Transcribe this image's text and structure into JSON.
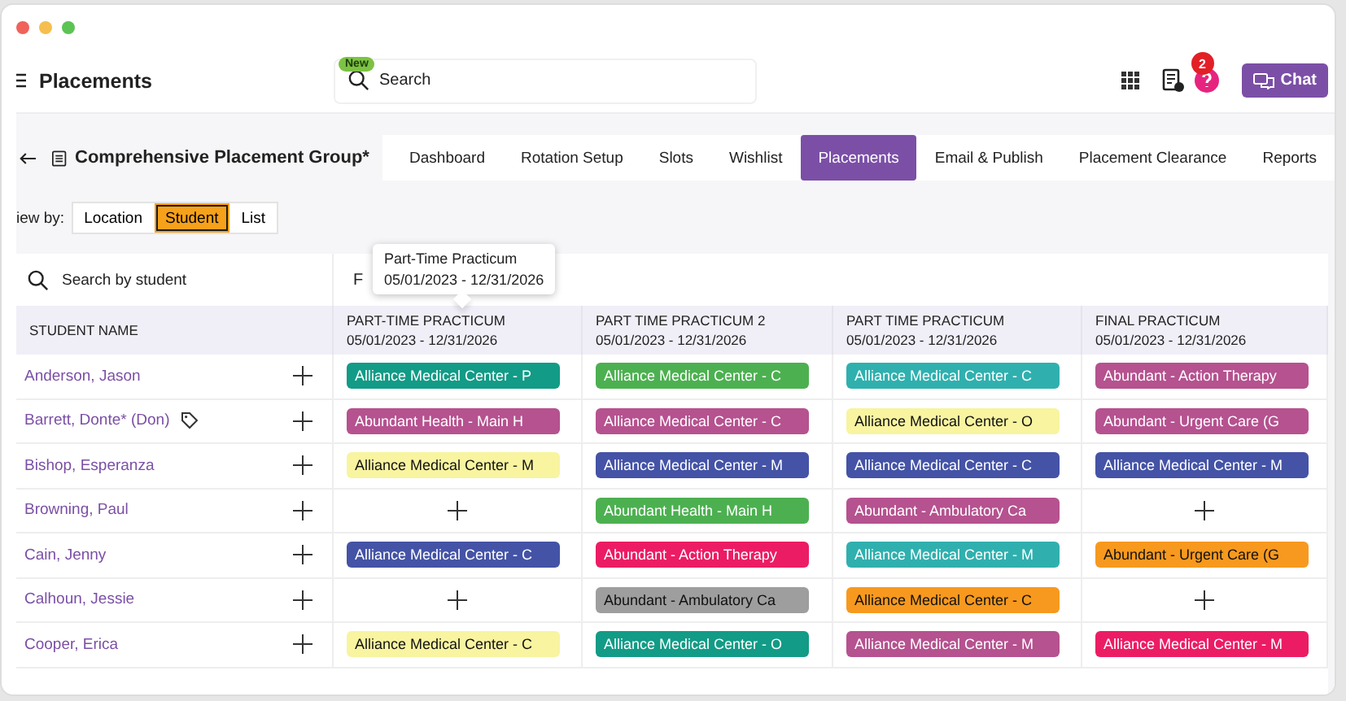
{
  "header": {
    "title": "Placements",
    "badge": "New",
    "search": {
      "placeholder": "Search"
    },
    "notification_count": "2",
    "chat_button": "Chat"
  },
  "group": {
    "title": "Comprehensive Placement Group*"
  },
  "tabs": [
    {
      "label": "Dashboard",
      "selected": false
    },
    {
      "label": "Rotation Setup",
      "selected": false
    },
    {
      "label": "Slots",
      "selected": false
    },
    {
      "label": "Wishlist",
      "selected": false
    },
    {
      "label": "Placements",
      "selected": true
    },
    {
      "label": "Email & Publish",
      "selected": false
    },
    {
      "label": "Placement Clearance",
      "selected": false
    },
    {
      "label": "Reports",
      "selected": false
    }
  ],
  "view_by": {
    "label": "iew by:",
    "options": [
      {
        "label": "Location",
        "selected": false
      },
      {
        "label": "Student",
        "selected": true
      },
      {
        "label": "List",
        "selected": false
      }
    ]
  },
  "student_search": {
    "placeholder": "Search by student"
  },
  "filter": {
    "label": "F"
  },
  "tooltip": {
    "title": "Part-Time Practicum",
    "dates": "05/01/2023 - 12/31/2026"
  },
  "table": {
    "columns": [
      {
        "title": "STUDENT NAME"
      },
      {
        "title": "PART-TIME PRACTICUM",
        "dates": "05/01/2023 - 12/31/2026"
      },
      {
        "title": "PART TIME PRACTICUM 2",
        "dates": "05/01/2023 - 12/31/2026"
      },
      {
        "title": "PART TIME PRACTICUM",
        "dates": "05/01/2023 - 12/31/2026"
      },
      {
        "title": "FINAL PRACTICUM",
        "dates": "05/01/2023 - 12/31/2026"
      }
    ],
    "rows": [
      {
        "cells": [
          {
            "kind": "student",
            "name": "Anderson, Jason",
            "tagged": false
          },
          {
            "kind": "placement",
            "text": "Alliance Medical Center - P",
            "color": "#129b86"
          },
          {
            "kind": "placement",
            "text": "Alliance Medical Center - C",
            "color": "#4cb050"
          },
          {
            "kind": "placement",
            "text": "Alliance Medical Center - C",
            "color": "#2fb0ae"
          },
          {
            "kind": "placement",
            "text": "Abundant - Action Therapy",
            "color": "#b5528f"
          }
        ]
      },
      {
        "cells": [
          {
            "kind": "student",
            "name": "Barrett, Donte* (Don)",
            "tagged": true
          },
          {
            "kind": "placement",
            "text": "Abundant Health - Main H",
            "color": "#b5528f"
          },
          {
            "kind": "placement",
            "text": "Alliance Medical Center - C",
            "color": "#b5528f"
          },
          {
            "kind": "placement",
            "text": "Alliance Medical Center - O",
            "color": "#f8f4a0"
          },
          {
            "kind": "placement",
            "text": "Abundant - Urgent Care (G",
            "color": "#b5528f"
          }
        ]
      },
      {
        "cells": [
          {
            "kind": "student",
            "name": "Bishop, Esperanza",
            "tagged": false
          },
          {
            "kind": "placement",
            "text": "Alliance Medical Center - M",
            "color": "#f8f4a0"
          },
          {
            "kind": "placement",
            "text": "Alliance Medical Center - M",
            "color": "#4453a6"
          },
          {
            "kind": "placement",
            "text": "Alliance Medical Center - C",
            "color": "#4453a6"
          },
          {
            "kind": "placement",
            "text": "Alliance Medical Center - M",
            "color": "#4453a6"
          }
        ]
      },
      {
        "cells": [
          {
            "kind": "student",
            "name": "Browning, Paul",
            "tagged": false
          },
          {
            "kind": "empty"
          },
          {
            "kind": "placement",
            "text": "Abundant Health - Main H",
            "color": "#4cb050"
          },
          {
            "kind": "placement",
            "text": "Abundant - Ambulatory Ca",
            "color": "#b5528f"
          },
          {
            "kind": "empty"
          }
        ]
      },
      {
        "cells": [
          {
            "kind": "student",
            "name": "Cain, Jenny",
            "tagged": false
          },
          {
            "kind": "placement",
            "text": "Alliance Medical Center - C",
            "color": "#4453a6"
          },
          {
            "kind": "placement",
            "text": "Abundant - Action Therapy",
            "color": "#ec1c64"
          },
          {
            "kind": "placement",
            "text": "Alliance Medical Center - M",
            "color": "#2fb0ae"
          },
          {
            "kind": "placement",
            "text": "Abundant - Urgent Care (G",
            "color": "#f7991e"
          }
        ]
      },
      {
        "cells": [
          {
            "kind": "student",
            "name": "Calhoun, Jessie",
            "tagged": false
          },
          {
            "kind": "empty"
          },
          {
            "kind": "placement",
            "text": "Abundant - Ambulatory Ca",
            "color": "#9e9e9e"
          },
          {
            "kind": "placement",
            "text": "Alliance Medical Center - C",
            "color": "#f7991e"
          },
          {
            "kind": "empty"
          }
        ]
      },
      {
        "cells": [
          {
            "kind": "student",
            "name": "Cooper, Erica",
            "tagged": false
          },
          {
            "kind": "placement",
            "text": "Alliance Medical Center - C",
            "color": "#f8f4a0"
          },
          {
            "kind": "placement",
            "text": "Alliance Medical Center - O",
            "color": "#129b86"
          },
          {
            "kind": "placement",
            "text": "Alliance Medical Center - M",
            "color": "#b5528f"
          },
          {
            "kind": "placement",
            "text": "Alliance Medical Center - M",
            "color": "#ec1c64"
          }
        ]
      }
    ]
  }
}
